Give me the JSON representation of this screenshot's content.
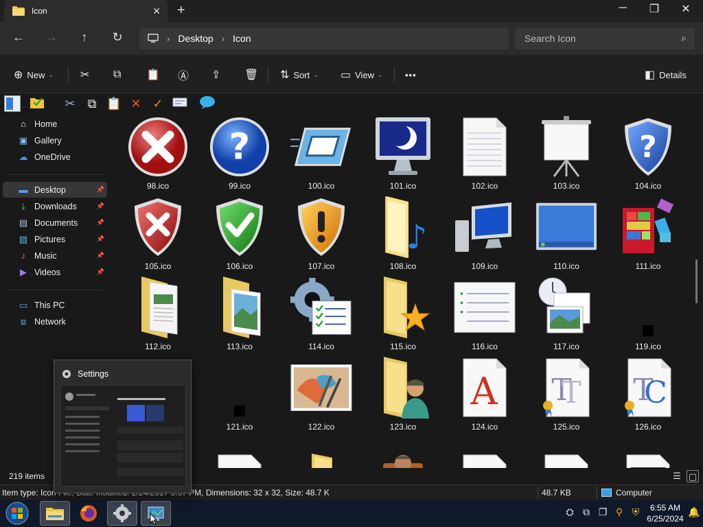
{
  "window": {
    "tab_title": "Icon",
    "controls": {
      "minimize": "─",
      "maximize": "❐",
      "close": "✕"
    }
  },
  "nav": {
    "breadcrumb": [
      "Desktop",
      "Icon"
    ],
    "search_placeholder": "Search Icon"
  },
  "toolbar": {
    "new_label": "New",
    "sort_label": "Sort",
    "view_label": "View",
    "more_label": "•••",
    "details_label": "Details"
  },
  "sidebar": {
    "items": [
      {
        "label": "Home",
        "icon": "home-icon"
      },
      {
        "label": "Gallery",
        "icon": "gallery-icon"
      },
      {
        "label": "OneDrive",
        "icon": "onedrive-icon"
      },
      {
        "label": "Desktop",
        "icon": "desktop-icon",
        "selected": true,
        "pinned": true
      },
      {
        "label": "Downloads",
        "icon": "downloads-icon",
        "pinned": true
      },
      {
        "label": "Documents",
        "icon": "documents-icon",
        "pinned": true
      },
      {
        "label": "Pictures",
        "icon": "pictures-icon",
        "pinned": true
      },
      {
        "label": "Music",
        "icon": "music-icon",
        "pinned": true
      },
      {
        "label": "Videos",
        "icon": "videos-icon",
        "pinned": true
      },
      {
        "label": "This PC",
        "icon": "this-pc-icon"
      },
      {
        "label": "Network",
        "icon": "network-icon"
      }
    ]
  },
  "files": {
    "items": [
      {
        "name": "98.ico",
        "icon": "error-x-icon"
      },
      {
        "name": "99.ico",
        "icon": "help-question-icon"
      },
      {
        "name": "100.ico",
        "icon": "window-frame-icon"
      },
      {
        "name": "101.ico",
        "icon": "monitor-moon-icon"
      },
      {
        "name": "102.ico",
        "icon": "blank-document-icon"
      },
      {
        "name": "103.ico",
        "icon": "projector-screen-icon"
      },
      {
        "name": "104.ico",
        "icon": "shield-question-icon"
      },
      {
        "name": "105.ico",
        "icon": "shield-error-icon"
      },
      {
        "name": "106.ico",
        "icon": "shield-check-icon"
      },
      {
        "name": "107.ico",
        "icon": "shield-warning-icon"
      },
      {
        "name": "108.ico",
        "icon": "folder-music-icon"
      },
      {
        "name": "109.ico",
        "icon": "computer-icon"
      },
      {
        "name": "110.ico",
        "icon": "desktop-screen-icon"
      },
      {
        "name": "111.ico",
        "icon": "defragment-blocks-icon"
      },
      {
        "name": "112.ico",
        "icon": "folder-documents-icon"
      },
      {
        "name": "113.ico",
        "icon": "folder-pictures-icon"
      },
      {
        "name": "114.ico",
        "icon": "gear-checklist-icon"
      },
      {
        "name": "115.ico",
        "icon": "folder-favorites-icon"
      },
      {
        "name": "116.ico",
        "icon": "list-window-icon"
      },
      {
        "name": "117.ico",
        "icon": "scheduled-task-icon"
      },
      {
        "name": "119.ico",
        "icon": "tiny-black-icon"
      },
      {
        "name": "121.ico",
        "icon": "tiny-black-icon"
      },
      {
        "name": "122.ico",
        "icon": "paint-brushes-icon"
      },
      {
        "name": "123.ico",
        "icon": "folder-user-icon"
      },
      {
        "name": "124.ico",
        "icon": "font-a-icon"
      },
      {
        "name": "125.ico",
        "icon": "font-tt-icon"
      },
      {
        "name": "126.ico",
        "icon": "font-tc-icon"
      }
    ]
  },
  "status": {
    "item_count": "219 items",
    "item_info": "Item type: Icon File, Date modified: 2/24/2017 3:37 PM, Dimensions: 32 x 32, Size: 48.7 KB",
    "size": "48.7 KB",
    "location": "Computer"
  },
  "thumbnail": {
    "title": "Settings"
  },
  "taskbar": {
    "time": "6:55 AM",
    "date": "6/25/2024"
  }
}
